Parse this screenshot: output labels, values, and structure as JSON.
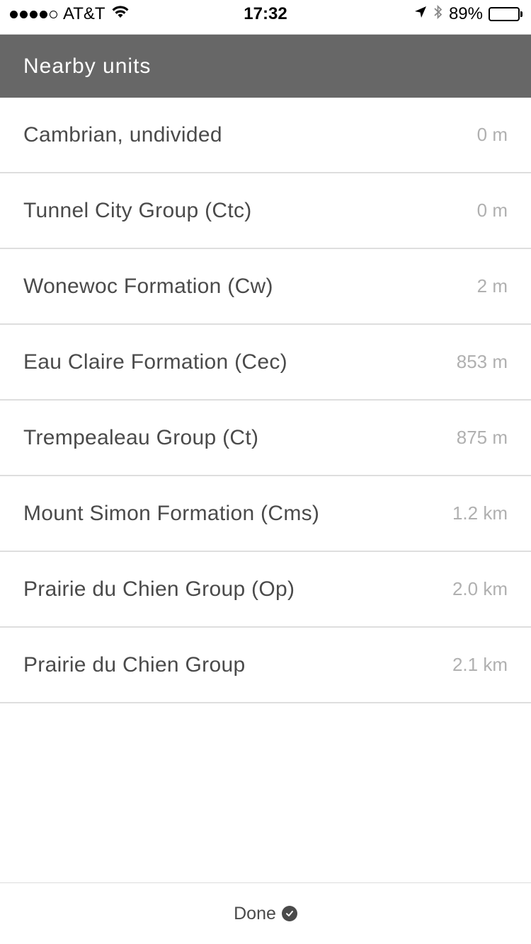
{
  "status_bar": {
    "carrier": "AT&T",
    "time": "17:32",
    "battery_percent": "89%",
    "battery_level": 0.89,
    "signal_bars_filled": 4,
    "signal_bars_total": 5,
    "icons": [
      "wifi-icon",
      "location-arrow-icon",
      "bluetooth-icon",
      "battery-icon"
    ]
  },
  "header": {
    "title": "Nearby units",
    "background_color": "#676767"
  },
  "units": [
    {
      "name": "Cambrian, undivided",
      "distance": "0 m"
    },
    {
      "name": "Tunnel City Group (Ctc)",
      "distance": "0 m"
    },
    {
      "name": "Wonewoc Formation (Cw)",
      "distance": "2 m"
    },
    {
      "name": "Eau Claire Formation (Cec)",
      "distance": "853 m"
    },
    {
      "name": "Trempealeau Group (Ct)",
      "distance": "875 m"
    },
    {
      "name": "Mount Simon Formation (Cms)",
      "distance": "1.2 km"
    },
    {
      "name": "Prairie du Chien Group (Op)",
      "distance": "2.0 km"
    },
    {
      "name": "Prairie du Chien Group",
      "distance": "2.1 km"
    }
  ],
  "footer": {
    "done_label": "Done",
    "done_icon": "check-circle-icon"
  }
}
